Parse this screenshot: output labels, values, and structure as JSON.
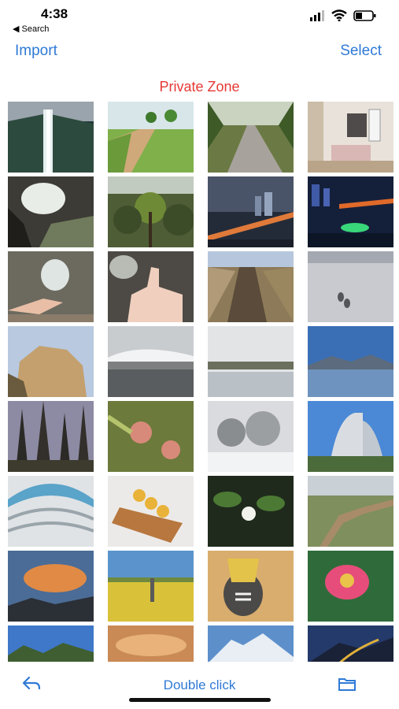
{
  "status": {
    "time": "4:38",
    "back_label": "◀ Search"
  },
  "nav": {
    "import_label": "Import",
    "select_label": "Select"
  },
  "title": "Private Zone",
  "toolbar": {
    "center_label": "Double click",
    "left_icon": "reply-icon",
    "right_icon": "folder-icon"
  },
  "colors": {
    "accent": "#2f7ad6",
    "title": "#e53935"
  },
  "photos": [
    {
      "name": "waterfall"
    },
    {
      "name": "grass-path"
    },
    {
      "name": "tree-lined-road"
    },
    {
      "name": "room-interior"
    },
    {
      "name": "cave-opening"
    },
    {
      "name": "forest-canopy"
    },
    {
      "name": "city-night-bridge"
    },
    {
      "name": "city-night-river"
    },
    {
      "name": "rock-arch-hand"
    },
    {
      "name": "thumbs-up-cave"
    },
    {
      "name": "railway-stairs"
    },
    {
      "name": "snow-footprints"
    },
    {
      "name": "cliff-rock"
    },
    {
      "name": "cloudy-wetland"
    },
    {
      "name": "misty-lake"
    },
    {
      "name": "mountain-lake"
    },
    {
      "name": "pine-forest"
    },
    {
      "name": "cut-bamboo"
    },
    {
      "name": "snowy-trees"
    },
    {
      "name": "curved-building"
    },
    {
      "name": "glass-ceiling"
    },
    {
      "name": "macarons-board"
    },
    {
      "name": "white-flower"
    },
    {
      "name": "great-wall"
    },
    {
      "name": "sunset-clouds"
    },
    {
      "name": "rapeseed-field"
    },
    {
      "name": "fruit-bowl"
    },
    {
      "name": "red-flower"
    },
    {
      "name": "blue-sky-valley"
    },
    {
      "name": "orange-clouds"
    },
    {
      "name": "snow-mountain"
    },
    {
      "name": "mountain-road-night"
    }
  ]
}
